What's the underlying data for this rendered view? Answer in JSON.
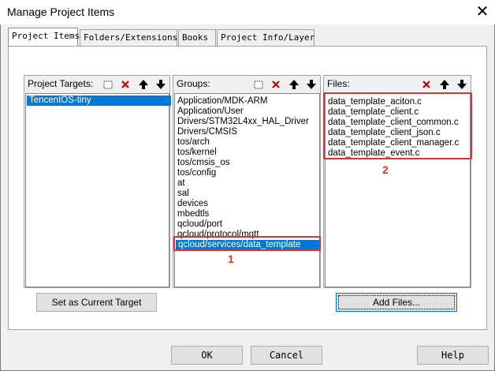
{
  "window": {
    "title": "Manage Project Items",
    "close_symbol": "✕"
  },
  "tabs": [
    {
      "label": "Project Items",
      "active": true
    },
    {
      "label": "Folders/Extensions",
      "active": false
    },
    {
      "label": "Books",
      "active": false
    },
    {
      "label": "Project Info/Layer",
      "active": false
    }
  ],
  "targets": {
    "label": "Project Targets:",
    "items": [
      "TencentOS-tiny"
    ],
    "selected_index": 0
  },
  "groups": {
    "label": "Groups:",
    "items": [
      "Application/MDK-ARM",
      "Application/User",
      "Drivers/STM32L4xx_HAL_Driver",
      "Drivers/CMSIS",
      "tos/arch",
      "tos/kernel",
      "tos/cmsis_os",
      "tos/config",
      "at",
      "sal",
      "devices",
      "mbedtls",
      "qcloud/port",
      "qcloud/protocol/mqtt",
      "qcloud/services/data_template"
    ],
    "selected_index": 14
  },
  "files": {
    "label": "Files:",
    "items": [
      "data_template_aciton.c",
      "data_template_client.c",
      "data_template_client_common.c",
      "data_template_client_json.c",
      "data_template_client_manager.c",
      "data_template_event.c"
    ]
  },
  "annotations": {
    "groups_marker": "1",
    "files_marker": "2",
    "highlight_color": "#e03030"
  },
  "buttons": {
    "set_target": "Set as Current Target",
    "add_files": "Add Files...",
    "ok": "OK",
    "cancel": "Cancel",
    "help": "Help"
  },
  "toolbar_icons": {
    "new": "new-item-icon",
    "delete": "delete-icon",
    "up": "move-up-icon",
    "down": "move-down-icon"
  },
  "colors": {
    "selection": "#0078d7",
    "dialog_bg": "#f0f0f0"
  }
}
